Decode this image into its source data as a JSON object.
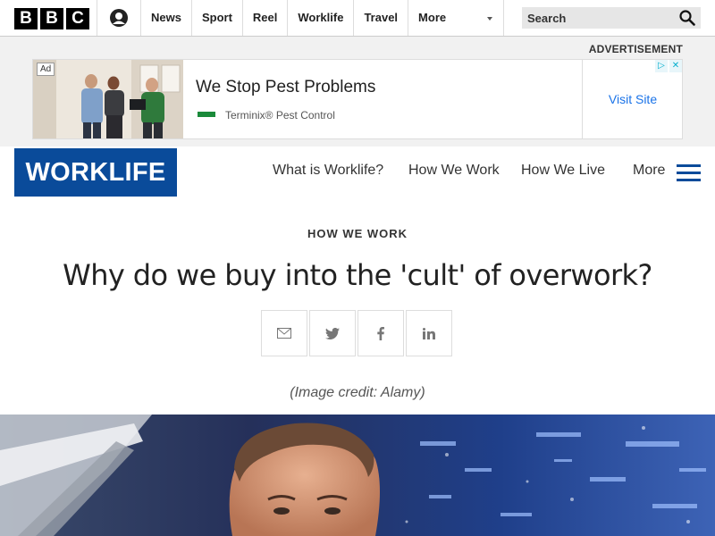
{
  "bbc": {
    "logo_letters": [
      "B",
      "B",
      "C"
    ],
    "nav": [
      "News",
      "Sport",
      "Reel",
      "Worklife",
      "Travel"
    ],
    "more_label": "More",
    "search_placeholder": "Search"
  },
  "advert": {
    "label": "ADVERTISEMENT",
    "badge": "Ad",
    "headline": "We Stop Pest Problems",
    "brand": "Terminix® Pest Control",
    "cta": "Visit Site"
  },
  "worklife": {
    "logo": "WORKLIFE",
    "nav": [
      "What is Worklife?",
      "How We Work",
      "How We Live"
    ],
    "more_label": "More"
  },
  "article": {
    "section": "HOW WE WORK",
    "headline": "Why do we buy into the 'cult' of overwork?",
    "image_credit": "(Image credit: Alamy)",
    "share_icons": [
      "email-icon",
      "twitter-icon",
      "facebook-icon",
      "linkedin-icon"
    ]
  },
  "colors": {
    "worklife_blue": "#0a4b9a",
    "ad_link_blue": "#1a73e8",
    "ad_choices_cyan": "#00aecd"
  }
}
